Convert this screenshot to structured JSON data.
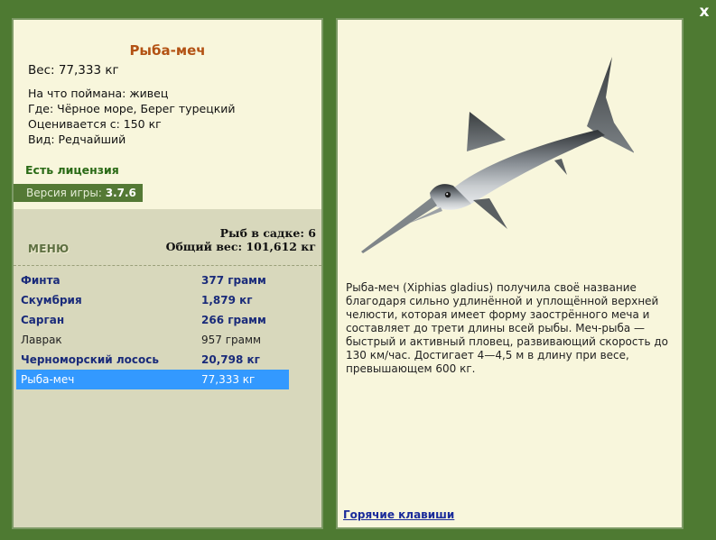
{
  "window": {
    "close_label": "x"
  },
  "fish": {
    "title": "Рыба-меч",
    "weight": "Вес: 77,333 кг",
    "caught_on": "На что поймана: живец",
    "location": "Где: Чёрное море, Берег турецкий",
    "valued_from": "Оценивается с: 150 кг",
    "rarity": "Вид: Редчайший",
    "description": "Рыба-меч (Xiphias gladius) получила своё название благодаря сильно удлинённой и уплощённой верхней челюсти, которая имеет форму заострённого меча и составляет до трети длины всей рыбы. Меч-рыба — быстрый и активный пловец, развивающий скорость до 130 км/час. Достигает 4—4,5 м в длину при весе, превышающем 600 кг."
  },
  "license": "Есть лицензия",
  "version": {
    "label": "Версия игры: ",
    "value": "3.7.6"
  },
  "menu_label": "МЕНЮ",
  "keepnet": {
    "count_text": "Рыб в садке: 6",
    "total_text": "Общий вес: 101,612 кг"
  },
  "catch_list": [
    {
      "name": "Финта",
      "weight": "377 грамм",
      "style": "bold"
    },
    {
      "name": "Скумбрия",
      "weight": "1,879 кг",
      "style": "bold"
    },
    {
      "name": "Сарган",
      "weight": "266 грамм",
      "style": "bold"
    },
    {
      "name": "Лаврак",
      "weight": "957 грамм",
      "style": "plain"
    },
    {
      "name": "Черноморский лосось",
      "weight": "20,798 кг",
      "style": "bold"
    },
    {
      "name": "Рыба-меч",
      "weight": "77,333 кг",
      "style": "selected"
    }
  ],
  "hotkeys_label": "Горячие клавиши",
  "colors": {
    "background": "#4e7a32",
    "panel": "#f8f6dc",
    "title": "#b35214",
    "license": "#2a6a16",
    "list_bold": "#1a2b7a",
    "selection": "#3399ff",
    "link": "#1a2b9a"
  },
  "icons": {
    "close": "close-icon",
    "fish_image": "swordfish-image"
  }
}
